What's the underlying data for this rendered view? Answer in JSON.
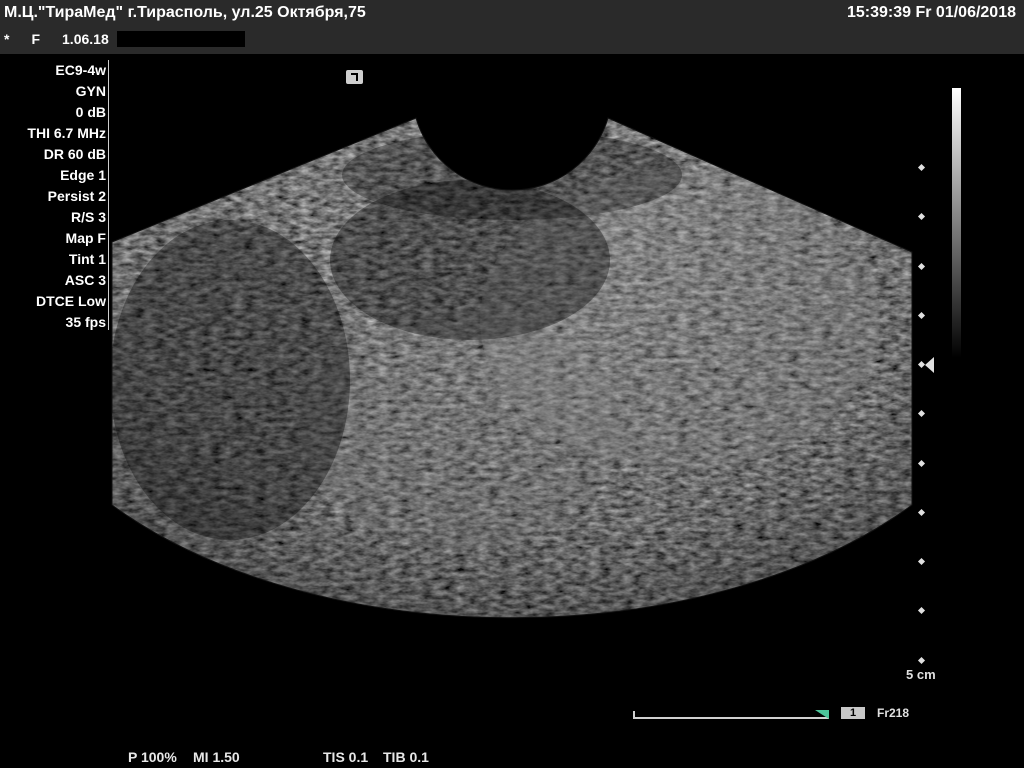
{
  "header": {
    "clinic": "М.Ц.\"ТираМед\" г.Тирасполь, ул.25 Октября,75",
    "datetime": "15:39:39  Fr  01/06/2018",
    "patient_marker": "*",
    "patient_sex": "F",
    "patient_date": "1.06.18"
  },
  "params": [
    "EC9-4w",
    "GYN",
    "0 dB",
    "THI 6.7 MHz",
    "DR 60 dB",
    "Edge 1",
    "Persist 2",
    "R/S 3",
    "Map F",
    "Tint 1",
    "ASC 3",
    "DTCE Low",
    "35 fps"
  ],
  "depth_scale": {
    "label": "5 cm",
    "max_depth_cm": 5
  },
  "cine": {
    "frame_badge": "1",
    "frame_label": "Fr218"
  },
  "bottom": {
    "power": "P 100%",
    "mi": "MI 1.50",
    "tis": "TIS 0.1",
    "tib": "TIB 0.1"
  },
  "colors": {
    "header_bg": "#2a2a2a",
    "accent": "#4cc49a",
    "text": "#ffffff"
  }
}
